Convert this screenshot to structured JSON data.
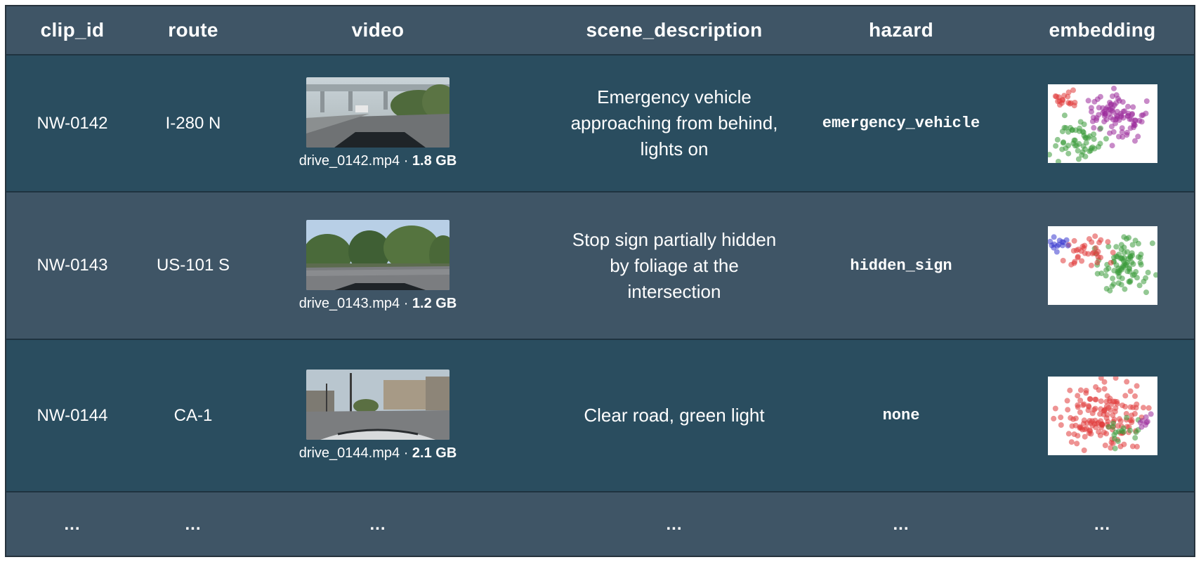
{
  "columns": [
    "clip_id",
    "route",
    "video",
    "scene_description",
    "hazard",
    "embedding"
  ],
  "rows": [
    {
      "clip_id": "NW-0142",
      "route": "I-280 N",
      "video_file": "drive_0142.mp4",
      "video_sep": " · ",
      "video_size": "1.8 GB",
      "scene_description": "Emergency vehicle approaching from behind, lights on",
      "hazard": "emergency_vehicle",
      "embedding_colors": [
        "#9b2a9b",
        "#3a9a3a",
        "#e03a3a"
      ]
    },
    {
      "clip_id": "NW-0143",
      "route": "US-101 S",
      "video_file": "drive_0143.mp4",
      "video_sep": " · ",
      "video_size": "1.2 GB",
      "scene_description": "Stop sign partially hidden by foliage at the intersection",
      "hazard": "hidden_sign",
      "embedding_colors": [
        "#3a9a3a",
        "#e03a3a",
        "#3a3ad0"
      ]
    },
    {
      "clip_id": "NW-0144",
      "route": "CA-1",
      "video_file": "drive_0144.mp4",
      "video_sep": " · ",
      "video_size": "2.1 GB",
      "scene_description": "Clear road, green light",
      "hazard": "none",
      "embedding_colors": [
        "#e03a3a",
        "#3a9a3a",
        "#9b2a9b"
      ]
    }
  ],
  "ellipsis": "...",
  "colors": {
    "header_bg": "#3f5566",
    "row_dark": "#2a4d5f",
    "row_light": "#3f5566"
  }
}
